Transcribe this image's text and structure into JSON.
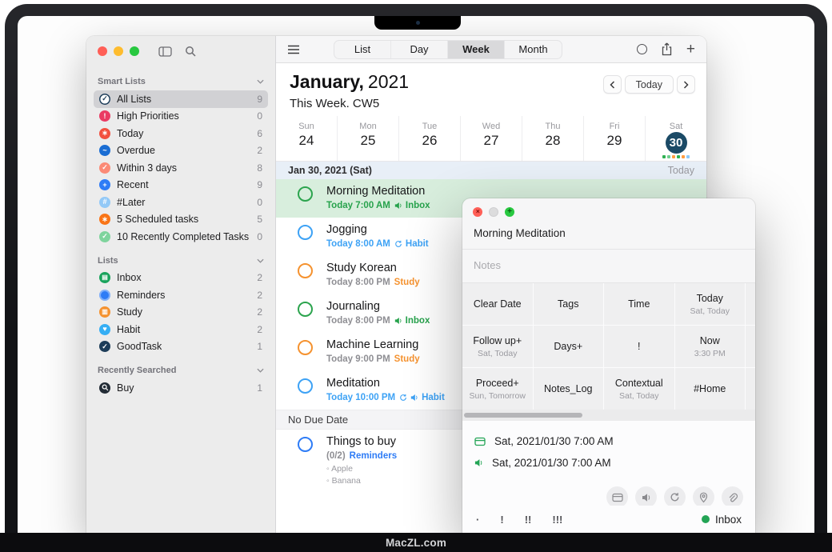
{
  "frame": {
    "watermark": "MacZL.com"
  },
  "sidebar": {
    "sections": [
      {
        "title": "Smart Lists",
        "items": [
          {
            "label": "All Lists",
            "count": "9",
            "icon": "check-circle-outline",
            "color": "#1d3d59",
            "glyph": "✓",
            "selected": true
          },
          {
            "label": "High Priorities",
            "count": "0",
            "icon": "exclamation-circle",
            "color": "#ea3b63",
            "glyph": "!"
          },
          {
            "label": "Today",
            "count": "6",
            "icon": "asterisk-circle",
            "color": "#f2503f",
            "glyph": "∗"
          },
          {
            "label": "Overdue",
            "count": "2",
            "icon": "wave-circle",
            "color": "#1a6dd3",
            "glyph": "~"
          },
          {
            "label": "Within 3 days",
            "count": "8",
            "icon": "check-circle",
            "color": "#fb8a76",
            "glyph": "✓"
          },
          {
            "label": "Recent",
            "count": "9",
            "icon": "plus-circle",
            "color": "#2e7cf6",
            "glyph": "+"
          },
          {
            "label": "#Later",
            "count": "0",
            "icon": "hash-circle",
            "color": "#93c9f7",
            "glyph": "#"
          },
          {
            "label": "5 Scheduled tasks",
            "count": "5",
            "icon": "asterisk-circle",
            "color": "#f97416",
            "glyph": "∗"
          },
          {
            "label": "10 Recently Completed Tasks",
            "count": "0",
            "icon": "check-circle",
            "color": "#7fd49d",
            "glyph": "✓"
          }
        ]
      },
      {
        "title": "Lists",
        "items": [
          {
            "label": "Inbox",
            "count": "2",
            "icon": "tray-circle",
            "color": "#19a35c",
            "glyph": "▤"
          },
          {
            "label": "Reminders",
            "count": "2",
            "icon": "dot-circle",
            "color": "#2e7cf6",
            "glyph": ""
          },
          {
            "label": "Study",
            "count": "2",
            "icon": "book-circle",
            "color": "#f5922f",
            "glyph": "▥"
          },
          {
            "label": "Habit",
            "count": "2",
            "icon": "heart-circle",
            "color": "#35aef4",
            "glyph": "♥"
          },
          {
            "label": "GoodTask",
            "count": "1",
            "icon": "check-circle",
            "color": "#1d3d59",
            "glyph": "✓"
          }
        ]
      },
      {
        "title": "Recently Searched",
        "items": [
          {
            "label": "Buy",
            "count": "1",
            "icon": "magnifier-circle",
            "color": "#232c36",
            "glyph": ""
          }
        ]
      }
    ]
  },
  "toolbar": {
    "view_tabs": [
      {
        "label": "List"
      },
      {
        "label": "Day"
      },
      {
        "label": "Week",
        "selected": true
      },
      {
        "label": "Month"
      }
    ]
  },
  "calendar_header": {
    "month": "January,",
    "year": "2021",
    "subtitle": "This Week. CW5",
    "nav_today": "Today"
  },
  "week_strip": {
    "days": [
      {
        "dow": "Sun",
        "date": "24"
      },
      {
        "dow": "Mon",
        "date": "25"
      },
      {
        "dow": "Tue",
        "date": "26"
      },
      {
        "dow": "Wed",
        "date": "27"
      },
      {
        "dow": "Thu",
        "date": "28"
      },
      {
        "dow": "Fri",
        "date": "29"
      },
      {
        "dow": "Sat",
        "date": "30",
        "selected": true
      }
    ],
    "selected_circle_color": "#1b4a66",
    "event_dot_colors": [
      "#30b152",
      "#6ece8f",
      "#ff9d42",
      "#30b152",
      "#ff9d42",
      "#8ec9f8"
    ]
  },
  "day_bar": {
    "label": "Jan 30, 2021 (Sat)",
    "right_label": "Today"
  },
  "tasks": [
    {
      "title": "Morning Meditation",
      "due": "Today 7:00 AM",
      "due_color": "#27a24c",
      "list": "Inbox",
      "list_color": "#27a24c",
      "circle": "#2ca44e",
      "alert": true,
      "selected": true
    },
    {
      "title": "Jogging",
      "due": "Today 8:00 AM",
      "due_color": "#3da2f5",
      "list": "Habit",
      "list_color": "#3da2f5",
      "circle": "#3da2f5",
      "repeat": true
    },
    {
      "title": "Study Korean",
      "due": "Today 8:00 PM",
      "due_color": "#8e8e93",
      "list": "Study",
      "list_color": "#f5922f",
      "circle": "#f5922f"
    },
    {
      "title": "Journaling",
      "due": "Today 8:00 PM",
      "due_color": "#8e8e93",
      "list": "Inbox",
      "list_color": "#27a24c",
      "circle": "#2ca44e",
      "alert": true
    },
    {
      "title": "Machine Learning",
      "due": "Today 9:00 PM",
      "due_color": "#8e8e93",
      "list": "Study",
      "list_color": "#f5922f",
      "circle": "#f5922f"
    },
    {
      "title": "Meditation",
      "due": "Today 10:00 PM",
      "due_color": "#3da2f5",
      "list": "Habit",
      "list_color": "#3da2f5",
      "circle": "#3da2f5",
      "repeat": true,
      "alert": true
    },
    {
      "title": "Things to buy",
      "progress": "(0/2)",
      "progress_color": "#8e8e93",
      "list": "Reminders",
      "list_color": "#2e7cf6",
      "circle": "#2e7cf6",
      "subitems": [
        "Apple",
        "Banana"
      ]
    }
  ],
  "no_due_date_label": "No Due Date",
  "popup": {
    "title": "Morning Meditation",
    "notes_placeholder": "Notes",
    "quick_actions": [
      [
        {
          "label": "Clear Date"
        },
        {
          "label": "Tags"
        },
        {
          "label": "Time"
        },
        {
          "label": "Today",
          "sub": "Sat, Today"
        }
      ],
      [
        {
          "label": "Follow up+",
          "sub": "Sat, Today"
        },
        {
          "label": "Days+"
        },
        {
          "label": "!"
        },
        {
          "label": "Now",
          "sub": "3:30 PM"
        }
      ],
      [
        {
          "label": "Proceed+",
          "sub": "Sun, Tomorrow"
        },
        {
          "label": "Notes_Log"
        },
        {
          "label": "Contextual",
          "sub": "Sat, Today"
        },
        {
          "label": "#Home"
        }
      ]
    ],
    "due_row": {
      "icon": "calendar-icon",
      "text": "Sat, 2021/01/30 7:00 AM"
    },
    "alert_row": {
      "icon": "alert-speaker-icon",
      "text": "Sat, 2021/01/30 7:00 AM"
    },
    "action_icons": [
      "date-card-icon",
      "alert-speaker-icon",
      "repeat-icon",
      "location-icon",
      "attachment-icon"
    ],
    "priority_options": [
      "·",
      "!",
      "!!",
      "!!!"
    ],
    "list": {
      "name": "Inbox",
      "color": "#23a455"
    }
  }
}
